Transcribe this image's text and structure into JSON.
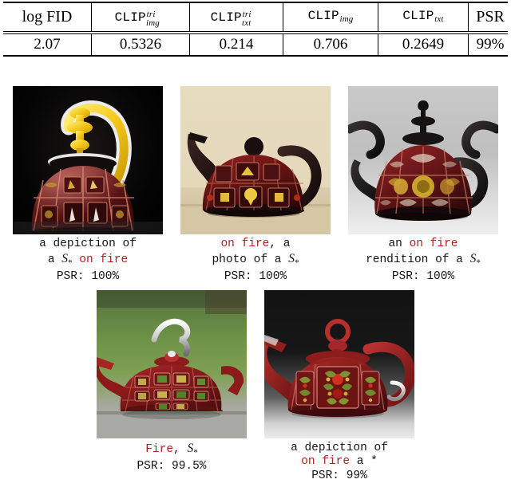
{
  "metrics_table": {
    "columns": [
      {
        "id": "logfid",
        "label": "log FID",
        "style": "plain"
      },
      {
        "id": "clip_img_tri",
        "base": "CLIP",
        "sup": "tri",
        "sub": "img",
        "style": "clip"
      },
      {
        "id": "clip_txt_tri",
        "base": "CLIP",
        "sup": "tri",
        "sub": "txt",
        "style": "clip"
      },
      {
        "id": "clip_img",
        "base": "CLIP",
        "sup": "",
        "sub": "img",
        "style": "clip"
      },
      {
        "id": "clip_txt",
        "base": "CLIP",
        "sup": "",
        "sub": "txt",
        "style": "clip"
      },
      {
        "id": "psr",
        "label": "PSR",
        "style": "plain"
      }
    ],
    "values": [
      "2.07",
      "0.5326",
      "0.214",
      "0.706",
      "0.2649",
      "99%"
    ]
  },
  "colors": {
    "prompt_highlight": "#b22222",
    "text": "#151515",
    "rule": "#000000"
  },
  "samples": [
    {
      "id": "sample-1",
      "row": 1,
      "background": "black",
      "caption_lines": [
        [
          {
            "t": "a depiction of",
            "hot": false
          }
        ],
        [
          {
            "t": "a ",
            "hot": false
          },
          {
            "t": "S*",
            "hot": false,
            "token": true
          },
          {
            "t": " on fire",
            "hot": true
          }
        ]
      ],
      "psr_label": "PSR: 100%"
    },
    {
      "id": "sample-2",
      "row": 1,
      "background": "cream",
      "caption_lines": [
        [
          {
            "t": "on fire",
            "hot": true
          },
          {
            "t": ", a",
            "hot": false
          }
        ],
        [
          {
            "t": "photo of a ",
            "hot": false
          },
          {
            "t": "S*",
            "hot": false,
            "token": true
          }
        ]
      ],
      "psr_label": "PSR: 100%"
    },
    {
      "id": "sample-3",
      "row": 1,
      "background": "gray",
      "caption_lines": [
        [
          {
            "t": "an ",
            "hot": false
          },
          {
            "t": "on fire",
            "hot": true
          }
        ],
        [
          {
            "t": "rendition of a ",
            "hot": false
          },
          {
            "t": "S*",
            "hot": false,
            "token": true
          }
        ]
      ],
      "psr_label": "PSR: 100%"
    },
    {
      "id": "sample-4",
      "row": 2,
      "background": "grass",
      "caption_lines": [
        [
          {
            "t": "Fire",
            "hot": true
          },
          {
            "t": ", ",
            "hot": false
          },
          {
            "t": "S*",
            "hot": false,
            "token": true
          }
        ]
      ],
      "psr_label": "PSR: 99.5%"
    },
    {
      "id": "sample-5",
      "row": 2,
      "background": "dark",
      "caption_lines": [
        [
          {
            "t": "a depiction of",
            "hot": false
          }
        ],
        [
          {
            "t": "on fire",
            "hot": true
          },
          {
            "t": " a *",
            "hot": false
          }
        ]
      ],
      "psr_label": "PSR: 99%"
    }
  ]
}
